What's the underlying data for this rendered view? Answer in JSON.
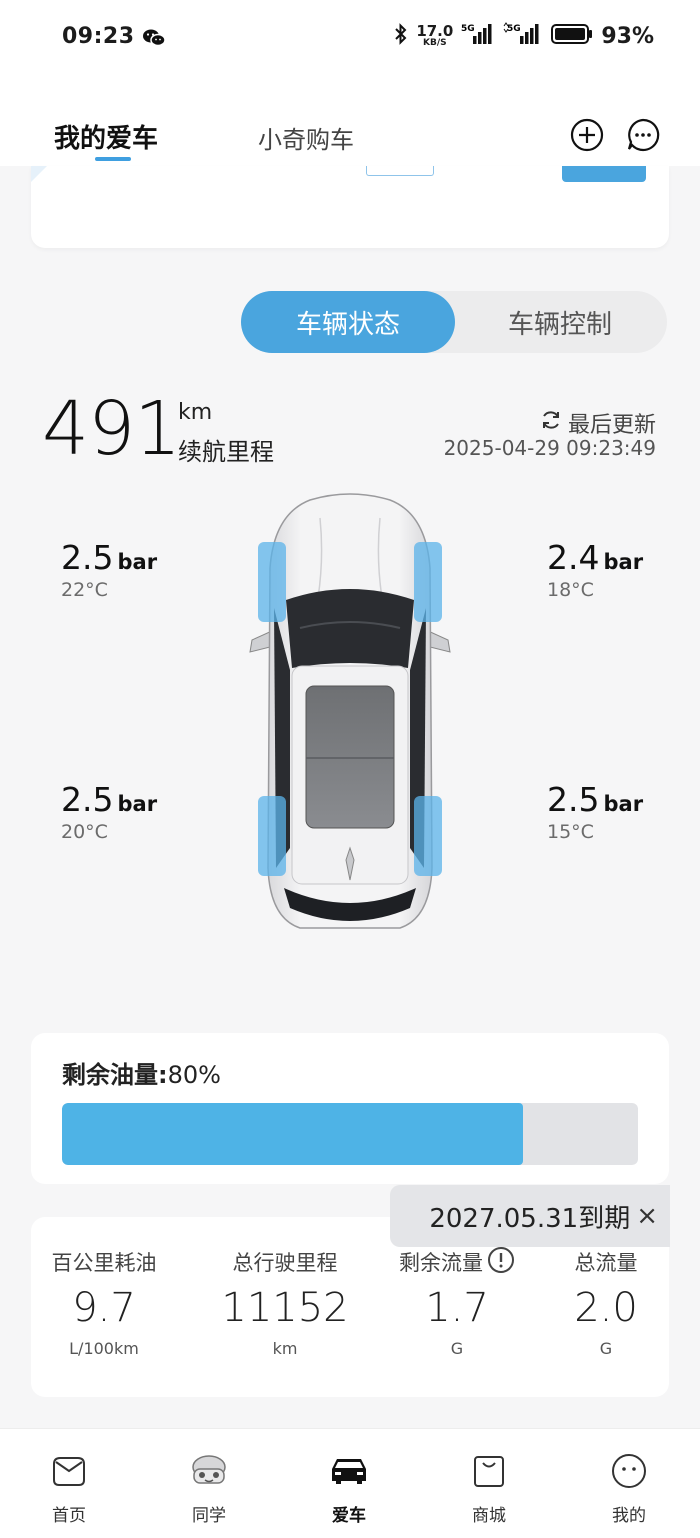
{
  "status_bar": {
    "time": "09:23",
    "net_speed": "17.0",
    "net_speed_unit": "KB/S",
    "sim1": "5G",
    "sim2": "5G",
    "battery": "93%",
    "icons": [
      "wechat-icon",
      "bluetooth-icon",
      "signal-icon",
      "battery-icon"
    ]
  },
  "header": {
    "tab_my_car": "我的爱车",
    "tab_buy_car": "小奇购车",
    "icons": [
      "add-icon",
      "message-icon"
    ]
  },
  "segment": {
    "vehicle_status": "车辆状态",
    "vehicle_control": "车辆控制",
    "selected": "车辆状态"
  },
  "range": {
    "value": "491",
    "unit": "km",
    "label": "续航里程",
    "last_update_label": "最后更新",
    "last_update_time": "2025-04-29 09:23:49"
  },
  "tyres": {
    "front_left": {
      "pressure": "2.5",
      "unit": "bar",
      "temp": "22°C"
    },
    "front_right": {
      "pressure": "2.4",
      "unit": "bar",
      "temp": "18°C"
    },
    "rear_left": {
      "pressure": "2.5",
      "unit": "bar",
      "temp": "20°C"
    },
    "rear_right": {
      "pressure": "2.5",
      "unit": "bar",
      "temp": "15°C"
    }
  },
  "fuel": {
    "label": "剩余油量:",
    "percent_text": "80%",
    "level_fraction": 0.8
  },
  "expiry": {
    "text": "2027.05.31到期",
    "close": "×"
  },
  "stats": [
    {
      "label": "百公里耗油",
      "value": "9.7",
      "unit": "L/100km"
    },
    {
      "label": "总行驶里程",
      "value": "11152",
      "unit": "km"
    },
    {
      "label": "剩余流量",
      "value": "1.7",
      "unit": "G"
    },
    {
      "label": "总流量",
      "value": "2.0",
      "unit": "G"
    }
  ],
  "bottom_nav": [
    {
      "label": "首页",
      "icon": "home-icon"
    },
    {
      "label": "同学",
      "icon": "classmate-icon"
    },
    {
      "label": "爱车",
      "icon": "car-icon",
      "active": true
    },
    {
      "label": "商城",
      "icon": "shop-icon"
    },
    {
      "label": "我的",
      "icon": "profile-icon"
    }
  ],
  "colors": {
    "accent": "#4aa5de",
    "fuel_bar": "#4eb3e6",
    "tyre_highlight": "#5bb3ea"
  }
}
